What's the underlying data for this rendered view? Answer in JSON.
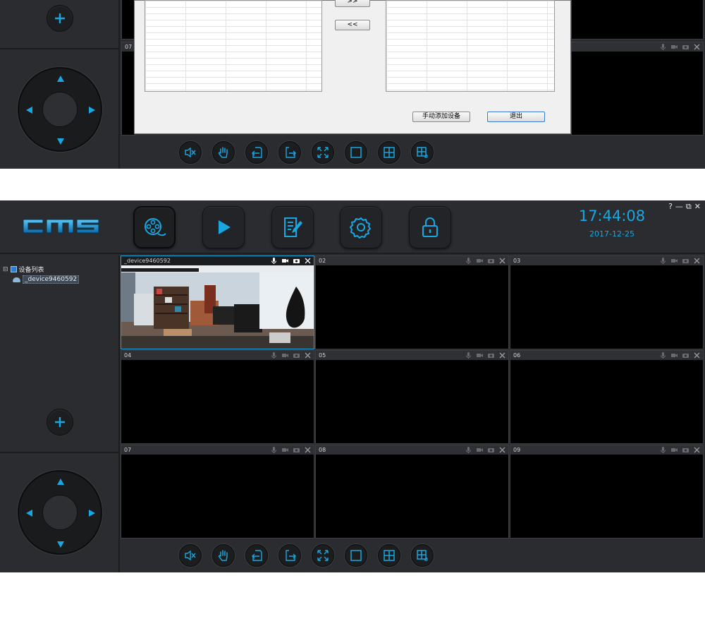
{
  "top_window": {
    "dialog": {
      "move_right_label": ">>",
      "move_left_label": "<<",
      "add_manual_label": "手动添加设备",
      "exit_label": "退出"
    },
    "tile_07_number": "07"
  },
  "main_window": {
    "logo_text": "cms",
    "clock": {
      "time": "17:44:08",
      "date": "2017-12-25"
    },
    "window_controls": {
      "help": "?",
      "minimize": "—",
      "restore": "⧉",
      "close": "✕"
    },
    "device_tree": {
      "root_expander": "⊟",
      "root_label": "设备列表",
      "device_label": "_device9460592"
    },
    "tiles": [
      {
        "label": "_device9460592"
      },
      {
        "label": "02"
      },
      {
        "label": "03"
      },
      {
        "label": "04"
      },
      {
        "label": "05"
      },
      {
        "label": "06"
      },
      {
        "label": "07"
      },
      {
        "label": "08"
      },
      {
        "label": "09"
      }
    ]
  },
  "colors": {
    "accent": "#1aa6e0",
    "panel_bg": "#2b2c2f",
    "tile_bg": "#000000",
    "tile_header": "#2f3033"
  },
  "icons": {
    "menu": [
      "film-reel-icon",
      "play-icon",
      "edit-document-icon",
      "gear-icon",
      "lock-icon"
    ],
    "bottom_bar": [
      "mute-icon",
      "hand-icon",
      "import-icon",
      "export-icon",
      "fullscreen-icon",
      "single-view-icon",
      "quad-view-icon",
      "nine-view-icon"
    ],
    "tile_header": [
      "microphone-icon",
      "video-camera-icon",
      "snapshot-camera-icon",
      "close-icon"
    ]
  }
}
